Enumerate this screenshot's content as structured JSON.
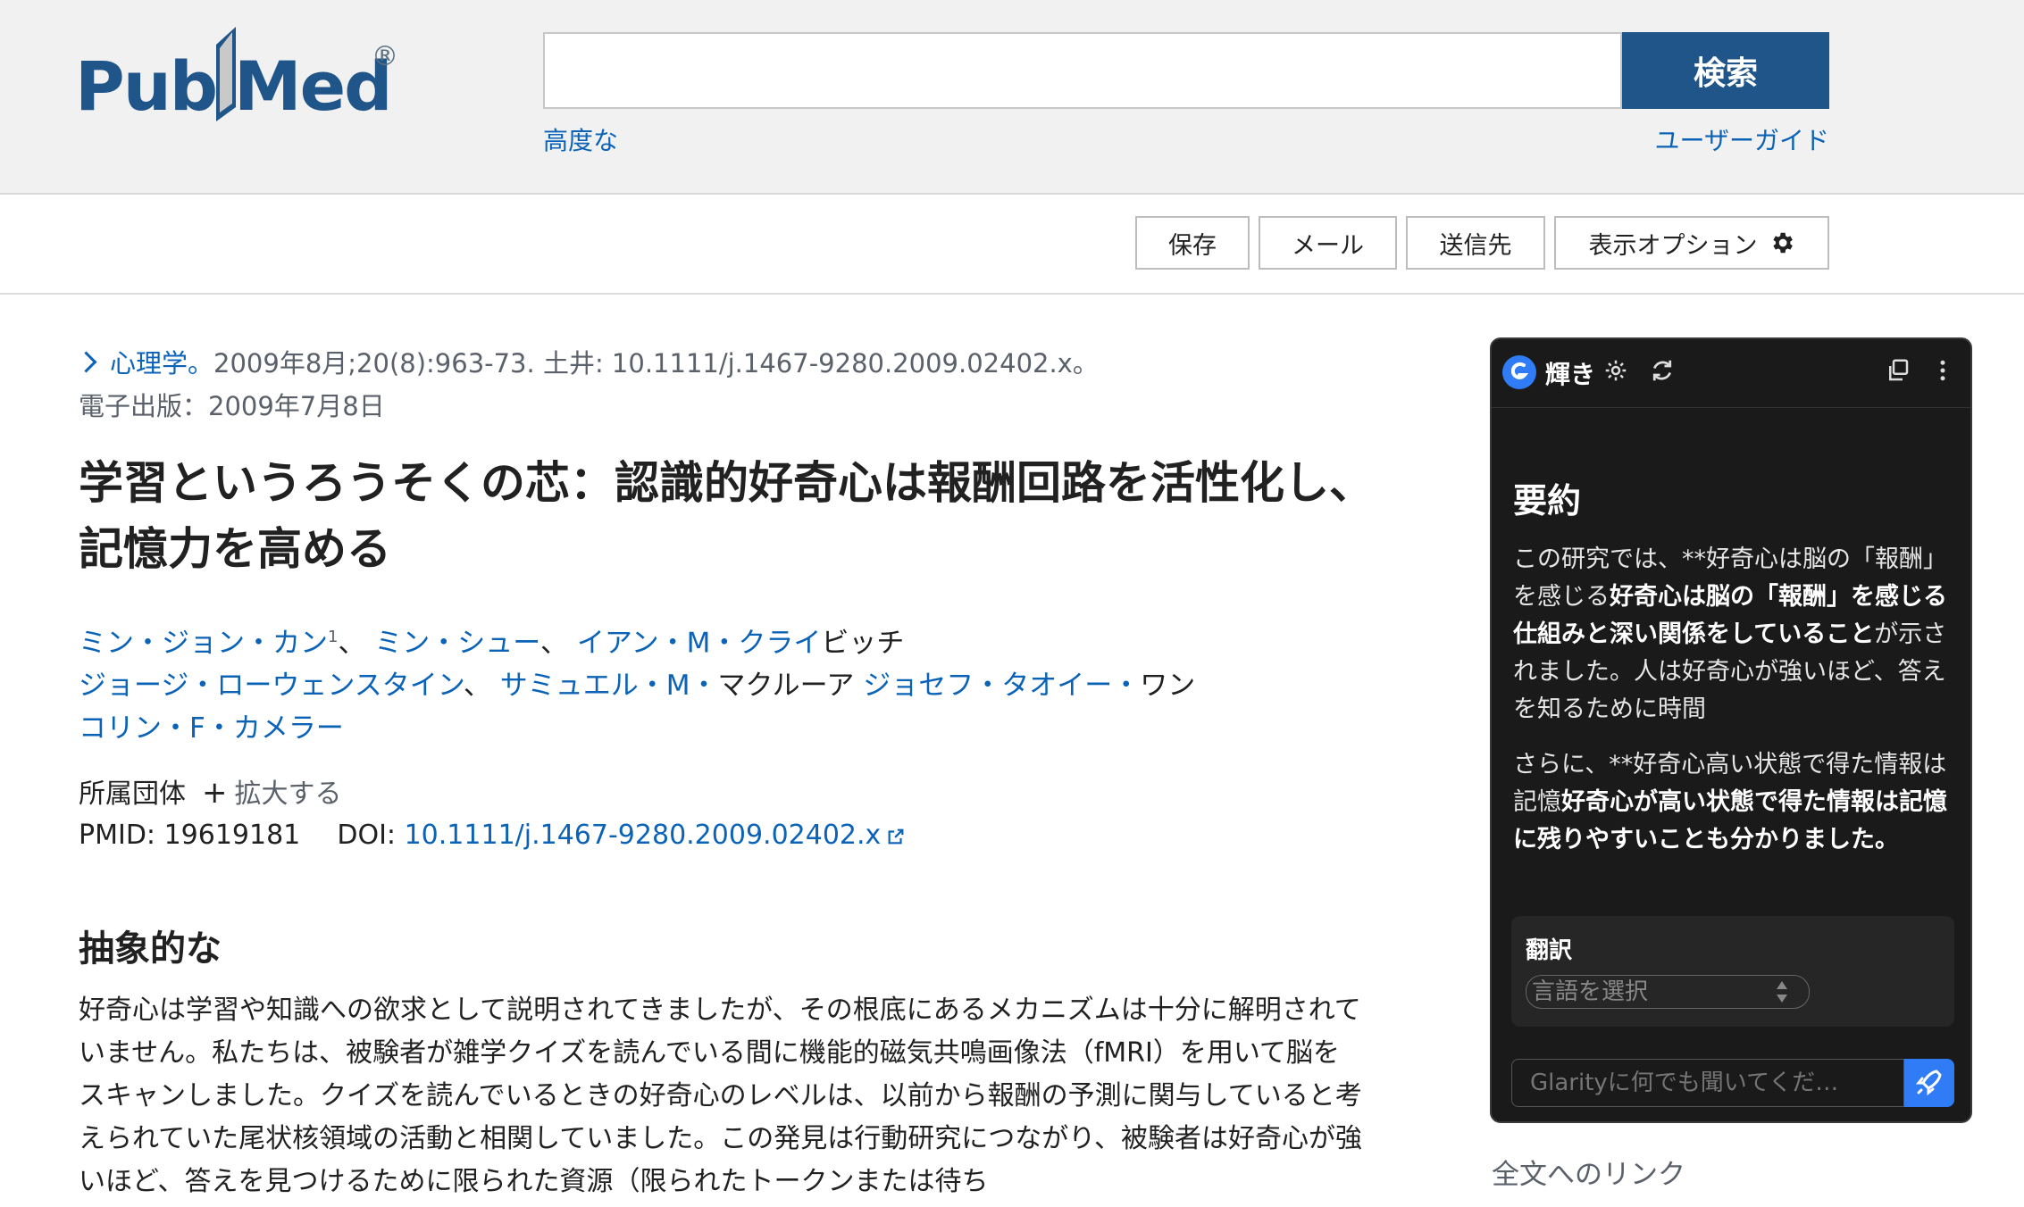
{
  "header": {
    "logo_pub": "Pub",
    "logo_med": "Med",
    "logo_reg": "®",
    "search_placeholder": "",
    "search_button": "検索",
    "advanced_link": "高度な",
    "user_guide_link": "ユーザーガイド"
  },
  "toolbar": {
    "save": "保存",
    "email": "メール",
    "send_to": "送信先",
    "display_options": "表示オプション"
  },
  "article": {
    "journal": "心理学。",
    "citation_rest": "2009年8月;20(8):963-73. 土井: 10.1111/j.1467-9280.2009.02402.x。",
    "epub": "電子出版：2009年7月8日",
    "title": "学習というろうそくの芯：認識的好奇心は報酬回路を活性化し、記憶力を高める",
    "authors_line1": [
      {
        "name": "ミン・ジョン・カン",
        "sup": "1",
        "sep": "、 "
      },
      {
        "name": "ミン・シュー",
        "sup": "",
        "sep": "、 "
      },
      {
        "name": "イアン・M・クライ",
        "sup": "",
        "sep": ""
      }
    ],
    "author_line1_tail": "ビッチ",
    "authors_line2": [
      {
        "name": "ジョージ・ローウェンスタイン",
        "sep": "、 "
      },
      {
        "name": "サミュエル・M・",
        "sep": ""
      }
    ],
    "author_line2_plain": "マクルーア ",
    "author_line2_link": "ジョセフ・タオイー・",
    "author_line2_tail": "ワン",
    "author_line3": "コリン・F・カメラー",
    "affiliations_label": "所属団体",
    "expand_label": "拡大する",
    "pmid_label": "PMID:",
    "pmid": "19619181",
    "doi_label": "DOI:",
    "doi": "10.1111/j.1467-9280.2009.02402.x",
    "abstract_heading": "抽象的な",
    "abstract_text": "好奇心は学習や知識への欲求として説明されてきましたが、その根底にあるメカニズムは十分に解明されていません。私たちは、被験者が雑学クイズを読んでいる間に機能的磁気共鳴画像法（fMRI）を用いて脳をスキャンしました。クイズを読んでいるときの好奇心のレベルは、以前から報酬の予測に関与していると考えられていた尾状核領域の活動と相関していました。この発見は行動研究につながり、被験者は好奇心が強いほど、答えを見つけるために限られた資源（限られたトークンまたは待ち"
  },
  "glarity": {
    "name": "輝き",
    "summary_heading": "要約",
    "p1_a": "この研究では、**好奇心は脳の「報酬」を感じる",
    "p1_b": "好奇心は脳の「報酬」を感じる仕組みと深い関係をしていること",
    "p1_c": "が示されました。人は好奇心が強いほど、答えを知るために時間",
    "p2_a": "さらに、**好奇心高い状態で得た情報は記憶",
    "p2_b": "好奇心が高い状態で得た情報は記憶に残りやすいことも分かりま",
    "p2_c": "した。",
    "translate_label": "翻訳",
    "language_select": "言語を選択",
    "ask_placeholder": "Glarityに何でも聞いてくだ…"
  },
  "sidebar": {
    "full_text_links": "全文へのリンク"
  },
  "colors": {
    "brand_blue": "#20558a",
    "link_blue": "#0b63b8",
    "panel_bg": "#1a1a1a",
    "accent_blue": "#2f7cf6"
  }
}
